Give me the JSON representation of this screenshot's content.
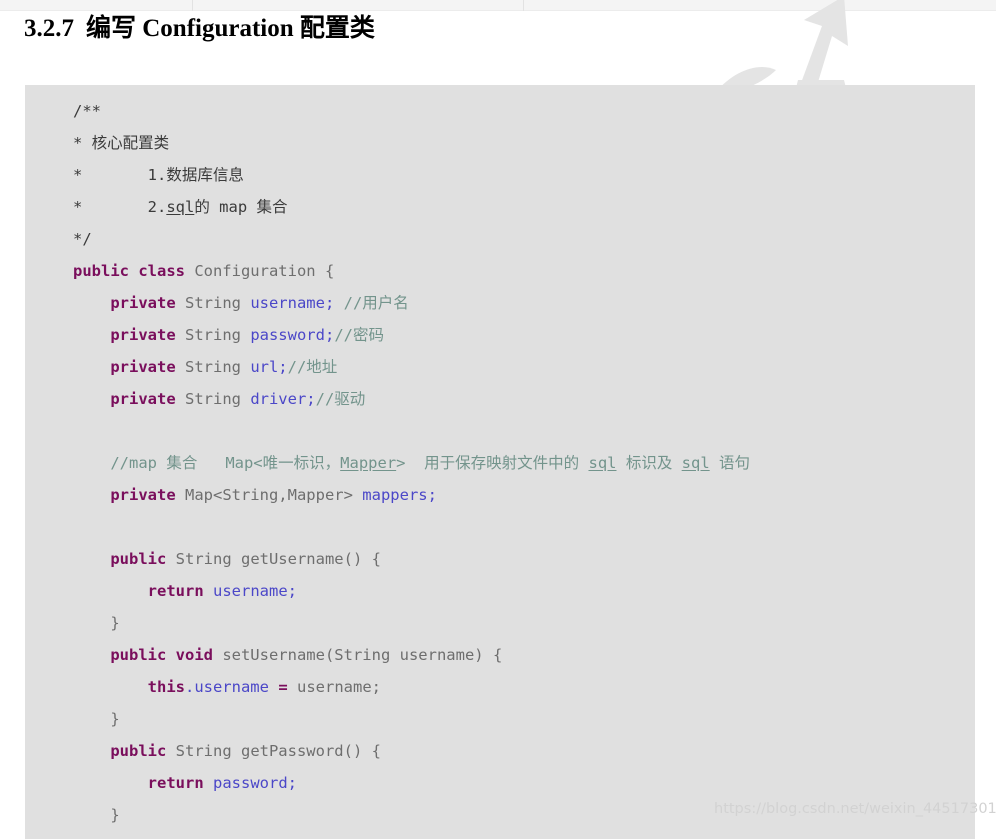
{
  "top_strip": {
    "present": true,
    "background_color": "#f4f4f4",
    "divider_color": "#e2e2e2"
  },
  "heading": {
    "number": "3.2.7",
    "text": "编写 Configuration 配置类",
    "color": "#000000"
  },
  "watermarks": {
    "decorative_shape_name": "stylized-brush-glyph",
    "decorative_color": "#e4e4e4",
    "url_text": "https://blog.csdn.net/weixin_44517301",
    "url_color": "#d2d2d2"
  },
  "code_block": {
    "background_color": "#e0e0e0",
    "keyword_color": "#7a0e5c",
    "type_color": "#6e6e6e",
    "field_color": "#4b47c8",
    "comment_color": "#73948c",
    "javadoc_color": "#3b3b3b",
    "language": "java",
    "lines": [
      {
        "id": "l1",
        "tokens": [
          {
            "t": "/**",
            "c": "jdoc"
          }
        ],
        "indent": 0
      },
      {
        "id": "l2",
        "tokens": [
          {
            "t": "* 核心配置类",
            "c": "jdoc"
          }
        ],
        "indent": 0
      },
      {
        "id": "l3",
        "tokens": [
          {
            "t": "*       1.数据库信息",
            "c": "jdoc"
          }
        ],
        "indent": 0
      },
      {
        "id": "l4",
        "tokens": [
          {
            "t": "*       2.",
            "c": "jdoc"
          },
          {
            "t": "sql",
            "c": "jdoc u"
          },
          {
            "t": "的 map 集合",
            "c": "jdoc"
          }
        ],
        "indent": 0
      },
      {
        "id": "l5",
        "tokens": [
          {
            "t": "*/",
            "c": "jdoc"
          }
        ],
        "indent": 0
      },
      {
        "id": "l6",
        "tokens": [
          {
            "t": "public class",
            "c": "kw"
          },
          {
            "t": " Configuration {",
            "c": "typ"
          }
        ],
        "indent": 0
      },
      {
        "id": "l7",
        "tokens": [
          {
            "t": "private",
            "c": "kw"
          },
          {
            "t": " String ",
            "c": "typ"
          },
          {
            "t": "username;",
            "c": "fld"
          },
          {
            "t": " //用户名",
            "c": "cmt"
          }
        ],
        "indent": 1
      },
      {
        "id": "l8",
        "tokens": [
          {
            "t": "private",
            "c": "kw"
          },
          {
            "t": " String ",
            "c": "typ"
          },
          {
            "t": "password;",
            "c": "fld"
          },
          {
            "t": "//密码",
            "c": "cmt"
          }
        ],
        "indent": 1
      },
      {
        "id": "l9",
        "tokens": [
          {
            "t": "private",
            "c": "kw"
          },
          {
            "t": " String ",
            "c": "typ"
          },
          {
            "t": "url;",
            "c": "fld"
          },
          {
            "t": "//地址",
            "c": "cmt"
          }
        ],
        "indent": 1
      },
      {
        "id": "l10",
        "tokens": [
          {
            "t": "private",
            "c": "kw"
          },
          {
            "t": " String ",
            "c": "typ"
          },
          {
            "t": "driver;",
            "c": "fld"
          },
          {
            "t": "//驱动",
            "c": "cmt"
          }
        ],
        "indent": 1
      },
      {
        "id": "l11",
        "tokens": [],
        "indent": 0
      },
      {
        "id": "l12",
        "tokens": [
          {
            "t": "//map 集合   Map<唯一标识，",
            "c": "cmt"
          },
          {
            "t": "Mapper",
            "c": "cmt u"
          },
          {
            "t": ">  用于保存映射文件中的 ",
            "c": "cmt"
          },
          {
            "t": "sql",
            "c": "cmt u"
          },
          {
            "t": " 标识及 ",
            "c": "cmt"
          },
          {
            "t": "sql",
            "c": "cmt u"
          },
          {
            "t": " 语句",
            "c": "cmt"
          }
        ],
        "indent": 1
      },
      {
        "id": "l13",
        "tokens": [
          {
            "t": "private",
            "c": "kw"
          },
          {
            "t": " Map<String,Mapper> ",
            "c": "typ"
          },
          {
            "t": "mappers;",
            "c": "fld"
          }
        ],
        "indent": 1
      },
      {
        "id": "l14",
        "tokens": [],
        "indent": 0
      },
      {
        "id": "l15",
        "tokens": [
          {
            "t": "public",
            "c": "kw"
          },
          {
            "t": " String getUsername() {",
            "c": "typ"
          }
        ],
        "indent": 1
      },
      {
        "id": "l16",
        "tokens": [
          {
            "t": "return",
            "c": "kw"
          },
          {
            "t": " ",
            "c": "typ"
          },
          {
            "t": "username;",
            "c": "fld"
          }
        ],
        "indent": 2
      },
      {
        "id": "l17",
        "tokens": [
          {
            "t": "}",
            "c": "typ"
          }
        ],
        "indent": 1
      },
      {
        "id": "l18",
        "tokens": [
          {
            "t": "public void",
            "c": "kw"
          },
          {
            "t": " setUsername(String username) {",
            "c": "typ"
          }
        ],
        "indent": 1
      },
      {
        "id": "l19",
        "tokens": [
          {
            "t": "this",
            "c": "kw"
          },
          {
            "t": ".username",
            "c": "fld"
          },
          {
            "t": " ",
            "c": "typ"
          },
          {
            "t": "=",
            "c": "kw"
          },
          {
            "t": " username;",
            "c": "typ"
          }
        ],
        "indent": 2
      },
      {
        "id": "l20",
        "tokens": [
          {
            "t": "}",
            "c": "typ"
          }
        ],
        "indent": 1
      },
      {
        "id": "l21",
        "tokens": [
          {
            "t": "public",
            "c": "kw"
          },
          {
            "t": " String getPassword() {",
            "c": "typ"
          }
        ],
        "indent": 1
      },
      {
        "id": "l22",
        "tokens": [
          {
            "t": "return",
            "c": "kw"
          },
          {
            "t": " ",
            "c": "typ"
          },
          {
            "t": "password;",
            "c": "fld"
          }
        ],
        "indent": 2
      },
      {
        "id": "l23",
        "tokens": [
          {
            "t": "}",
            "c": "typ"
          }
        ],
        "indent": 1
      }
    ]
  }
}
